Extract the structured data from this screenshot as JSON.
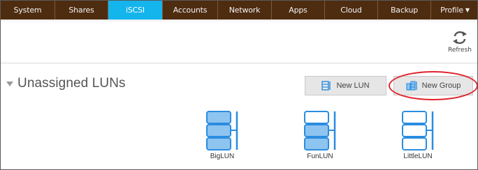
{
  "nav": {
    "items": [
      {
        "label": "System",
        "active": false
      },
      {
        "label": "Shares",
        "active": false
      },
      {
        "label": "iSCSI",
        "active": true
      },
      {
        "label": "Accounts",
        "active": false
      },
      {
        "label": "Network",
        "active": false
      },
      {
        "label": "Apps",
        "active": false
      },
      {
        "label": "Cloud",
        "active": false
      },
      {
        "label": "Backup",
        "active": false
      },
      {
        "label": "Profile",
        "active": false
      }
    ]
  },
  "toolbar": {
    "refresh_label": "Refresh",
    "refresh_icon": "refresh-icon"
  },
  "section": {
    "title": "Unassigned LUNs",
    "collapse_icon": "triangle-down-icon"
  },
  "actions": {
    "new_lun_label": "New LUN",
    "new_lun_icon": "lun-add-icon",
    "new_group_label": "New Group",
    "new_group_icon": "group-add-icon"
  },
  "luns": [
    {
      "name": "BigLUN",
      "fill": "full"
    },
    {
      "name": "FunLUN",
      "fill": "partial"
    },
    {
      "name": "LittleLUN",
      "fill": "empty"
    }
  ],
  "colors": {
    "nav_bg": "#4e2c10",
    "nav_active": "#14b4ec",
    "lun_fill": "#8ec4f0",
    "lun_stroke": "#2a8de0",
    "highlight": "#e0222b"
  }
}
